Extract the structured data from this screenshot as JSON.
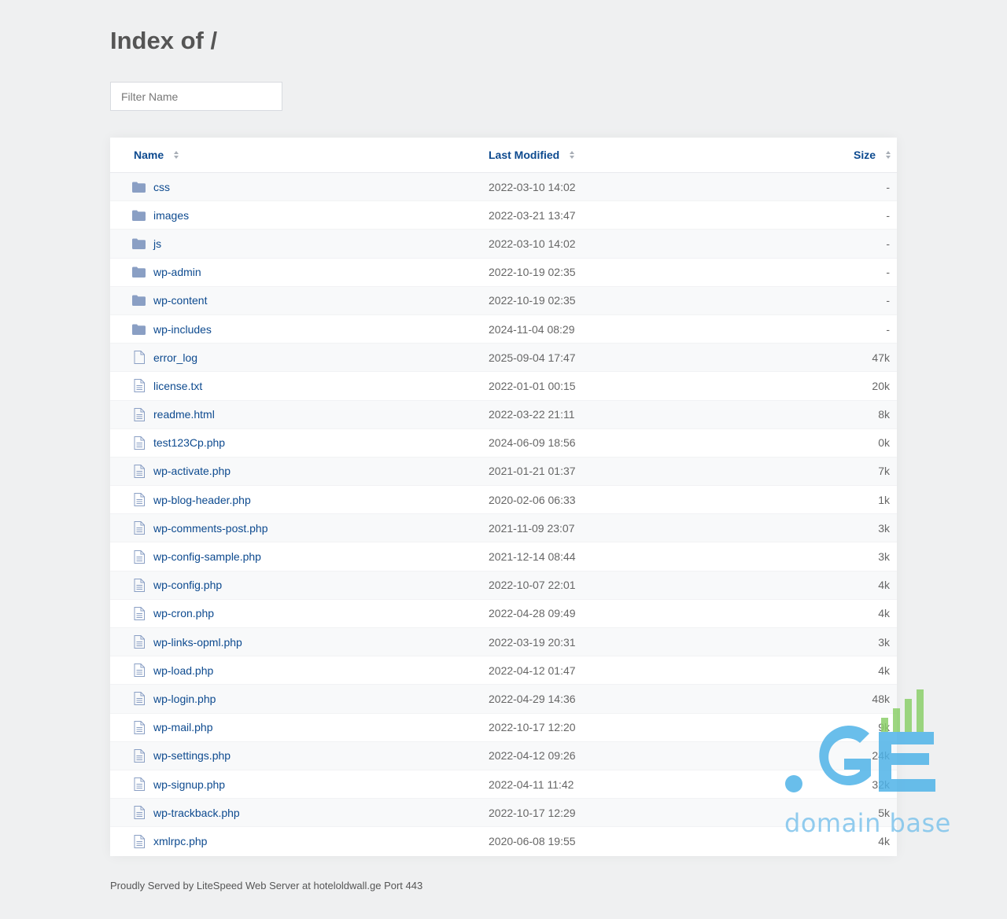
{
  "page": {
    "title": "Index of /"
  },
  "filter": {
    "placeholder": "Filter Name"
  },
  "table": {
    "headers": {
      "name": "Name",
      "modified": "Last Modified",
      "size": "Size"
    },
    "rows": [
      {
        "name": "css",
        "modified": "2022-03-10 14:02",
        "size": "-",
        "type": "folder"
      },
      {
        "name": "images",
        "modified": "2022-03-21 13:47",
        "size": "-",
        "type": "folder"
      },
      {
        "name": "js",
        "modified": "2022-03-10 14:02",
        "size": "-",
        "type": "folder"
      },
      {
        "name": "wp-admin",
        "modified": "2022-10-19 02:35",
        "size": "-",
        "type": "folder"
      },
      {
        "name": "wp-content",
        "modified": "2022-10-19 02:35",
        "size": "-",
        "type": "folder"
      },
      {
        "name": "wp-includes",
        "modified": "2024-11-04 08:29",
        "size": "-",
        "type": "folder"
      },
      {
        "name": "error_log",
        "modified": "2025-09-04 17:47",
        "size": "47k",
        "type": "file-blank"
      },
      {
        "name": "license.txt",
        "modified": "2022-01-01 00:15",
        "size": "20k",
        "type": "file"
      },
      {
        "name": "readme.html",
        "modified": "2022-03-22 21:11",
        "size": "8k",
        "type": "file"
      },
      {
        "name": "test123Cp.php",
        "modified": "2024-06-09 18:56",
        "size": "0k",
        "type": "file"
      },
      {
        "name": "wp-activate.php",
        "modified": "2021-01-21 01:37",
        "size": "7k",
        "type": "file"
      },
      {
        "name": "wp-blog-header.php",
        "modified": "2020-02-06 06:33",
        "size": "1k",
        "type": "file"
      },
      {
        "name": "wp-comments-post.php",
        "modified": "2021-11-09 23:07",
        "size": "3k",
        "type": "file"
      },
      {
        "name": "wp-config-sample.php",
        "modified": "2021-12-14 08:44",
        "size": "3k",
        "type": "file"
      },
      {
        "name": "wp-config.php",
        "modified": "2022-10-07 22:01",
        "size": "4k",
        "type": "file"
      },
      {
        "name": "wp-cron.php",
        "modified": "2022-04-28 09:49",
        "size": "4k",
        "type": "file"
      },
      {
        "name": "wp-links-opml.php",
        "modified": "2022-03-19 20:31",
        "size": "3k",
        "type": "file"
      },
      {
        "name": "wp-load.php",
        "modified": "2022-04-12 01:47",
        "size": "4k",
        "type": "file"
      },
      {
        "name": "wp-login.php",
        "modified": "2022-04-29 14:36",
        "size": "48k",
        "type": "file"
      },
      {
        "name": "wp-mail.php",
        "modified": "2022-10-17 12:20",
        "size": "9k",
        "type": "file"
      },
      {
        "name": "wp-settings.php",
        "modified": "2022-04-12 09:26",
        "size": "24k",
        "type": "file"
      },
      {
        "name": "wp-signup.php",
        "modified": "2022-04-11 11:42",
        "size": "32k",
        "type": "file"
      },
      {
        "name": "wp-trackback.php",
        "modified": "2022-10-17 12:29",
        "size": "5k",
        "type": "file"
      },
      {
        "name": "xmlrpc.php",
        "modified": "2020-06-08 19:55",
        "size": "4k",
        "type": "file"
      }
    ]
  },
  "footer": {
    "text": "Proudly Served by LiteSpeed Web Server at hoteloldwall.ge Port 443"
  },
  "watermark": {
    "logo": ".GE",
    "tagline": "domain base"
  },
  "colors": {
    "link": "#0d4a8f",
    "folder": "#8a9fc4",
    "background": "#eff0f1",
    "watermark": "#4fb3e8"
  }
}
